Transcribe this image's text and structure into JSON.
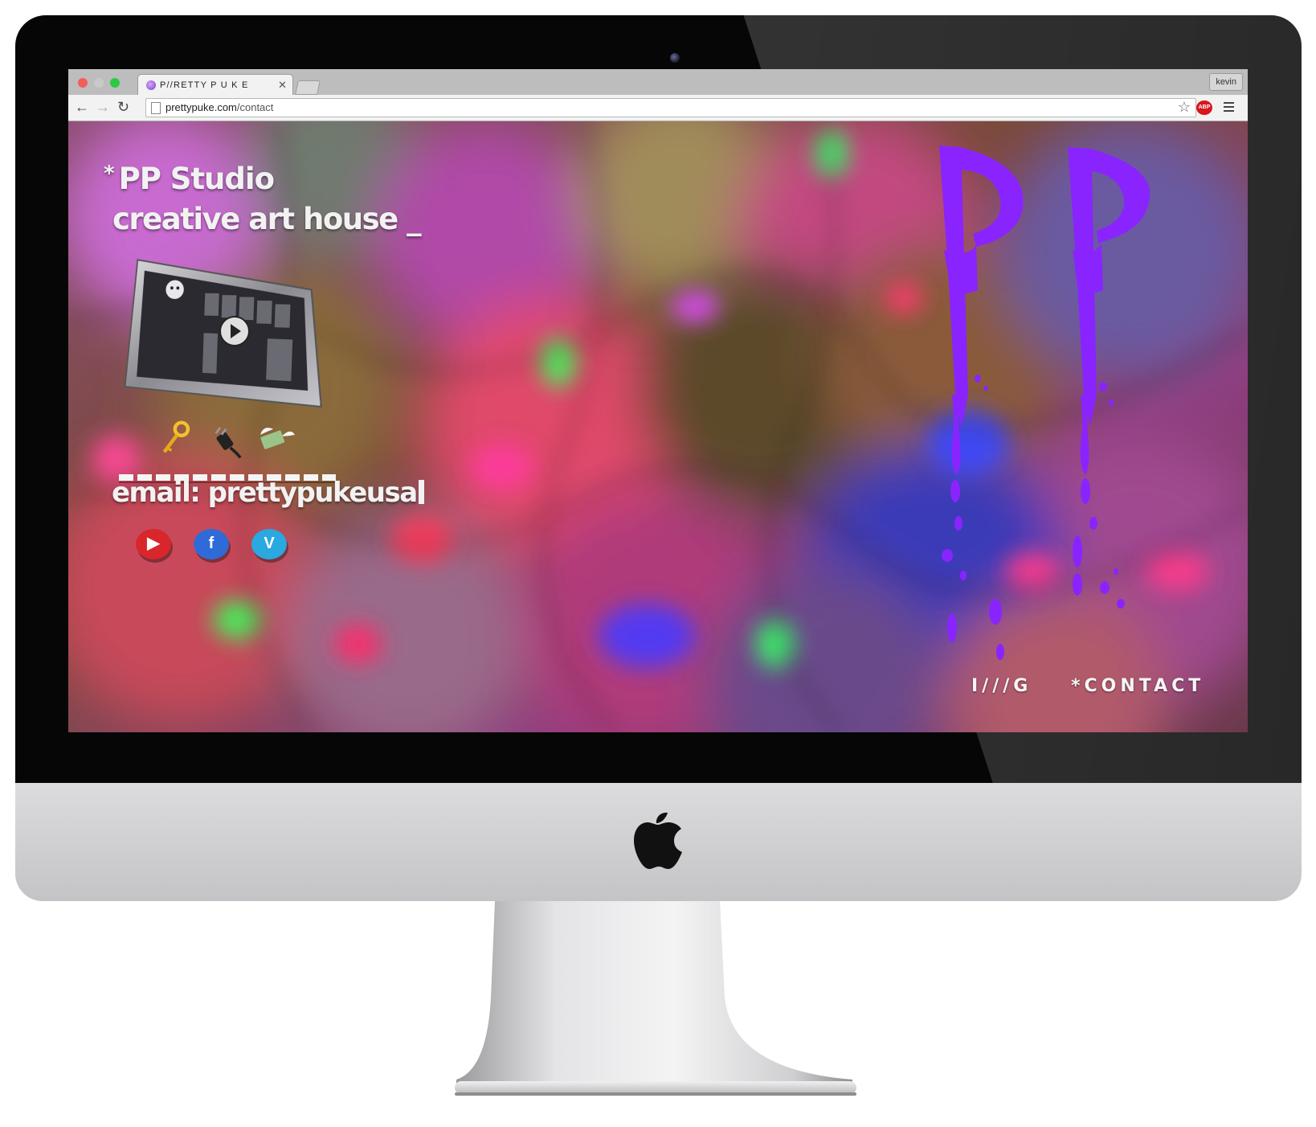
{
  "browser": {
    "tab_title": "P//RETTY P U K E",
    "profile_name": "kevin",
    "url_domain": "prettypuke.com",
    "url_path": "/contact"
  },
  "page": {
    "star_mark": "*",
    "headline": "PP Studio",
    "subline": "creative art house _",
    "email_text": "email: prettypukeusa",
    "social": [
      {
        "icon": "youtube-icon",
        "glyph": "▶",
        "color": "#d8262a"
      },
      {
        "icon": "facebook-icon",
        "glyph": "f",
        "color": "#2f6bd8"
      },
      {
        "icon": "vimeo-icon",
        "glyph": "V",
        "color": "#2aa8e0"
      }
    ],
    "emoji": [
      "key-emoji",
      "plug-emoji",
      "money-wings-emoji"
    ],
    "nav": {
      "ig_label": "I///G",
      "contact_label": "*CONTACT"
    },
    "logo_letters": "PP",
    "logo_color": "#8a24ff"
  }
}
